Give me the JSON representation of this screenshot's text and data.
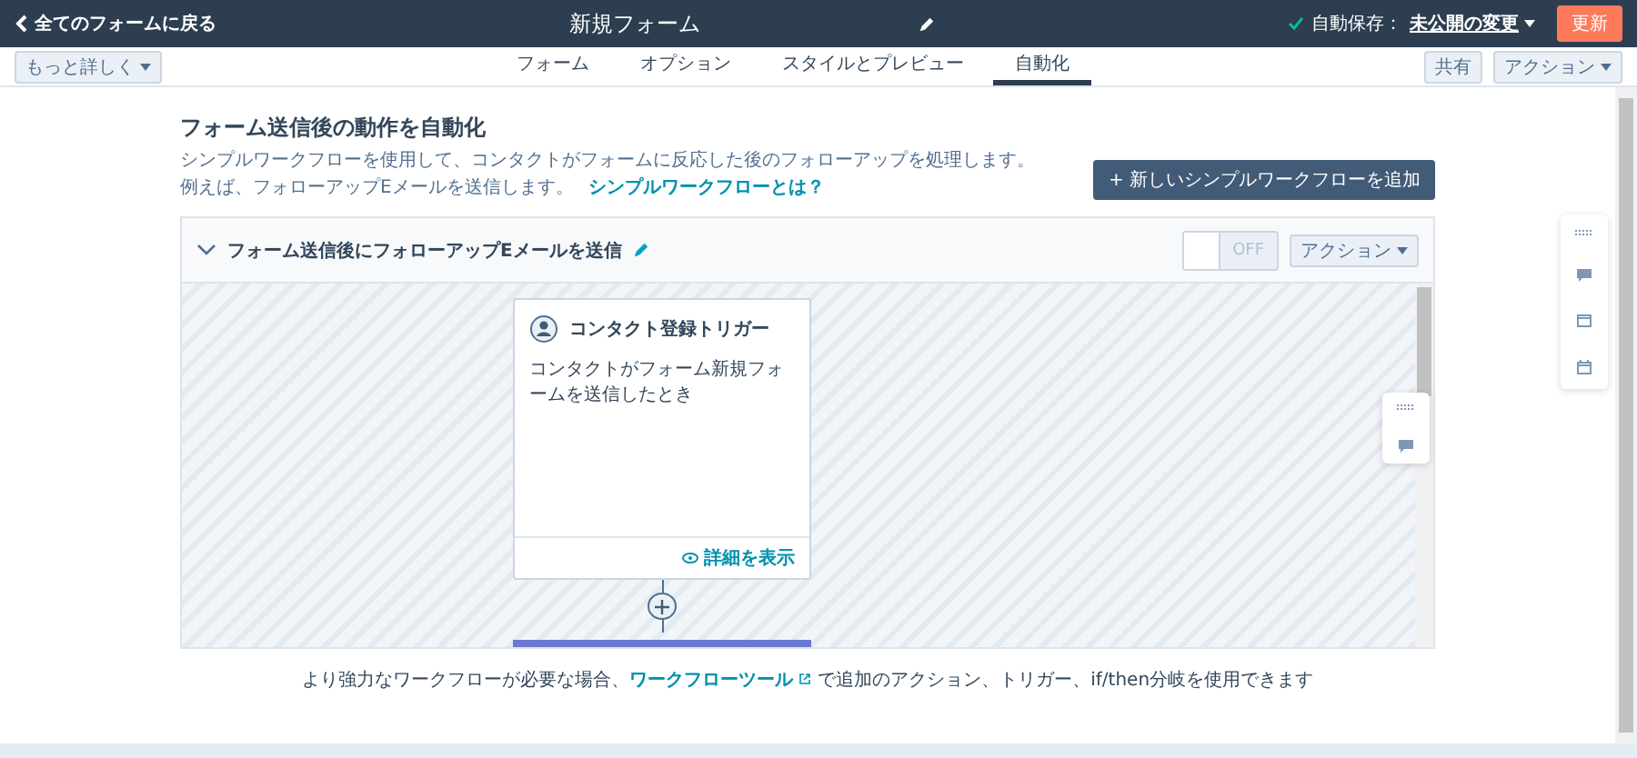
{
  "top_bar": {
    "back_link": "全てのフォームに戻る",
    "title": "新規フォーム",
    "autosave_label": "自動保存：",
    "autosave_link": "未公開の変更",
    "update_button": "更新"
  },
  "sub_nav": {
    "more_button": "もっと詳しく",
    "tabs": [
      {
        "label": "フォーム",
        "selected": false
      },
      {
        "label": "オプション",
        "selected": false
      },
      {
        "label": "スタイルとプレビュー",
        "selected": false
      },
      {
        "label": "自動化",
        "selected": true
      }
    ],
    "share_button": "共有",
    "actions_button": "アクション"
  },
  "section": {
    "title": "フォーム送信後の動作を自動化",
    "description": "シンプルワークフローを使用して、コンタクトがフォームに反応した後のフォローアップを処理します。",
    "example": "例えば、フォローアップEメールを送信します。",
    "help_link": "シンプルワークフローとは？",
    "add_button": "+ 新しいシンプルワークフローを追加"
  },
  "workflow": {
    "title": "フォーム送信後にフォローアップEメールを送信",
    "expanded": true,
    "toggle": {
      "label": "OFF",
      "on": false
    },
    "actions_button": "アクション",
    "trigger": {
      "title": "コンタクト登録トリガー",
      "text": "コンタクトがフォーム新規フォームを送信したとき",
      "details_link": "詳細を表示"
    }
  },
  "footer": {
    "before": "より強力なワークフローが必要な場合、",
    "link": "ワークフローツール",
    "after": "で追加のアクション、トリガー、if/then分岐を使用できます"
  }
}
